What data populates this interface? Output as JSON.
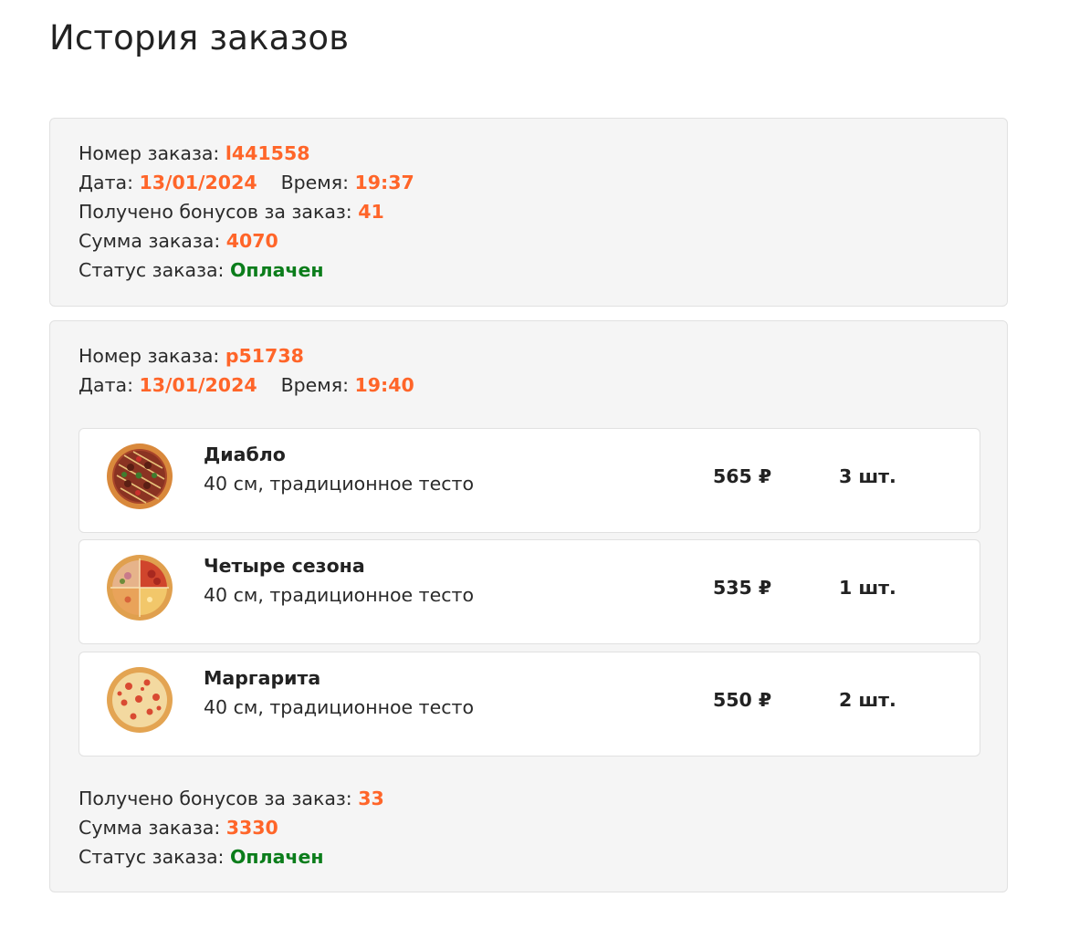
{
  "page": {
    "title": "История заказов"
  },
  "labels": {
    "order_number": "Номер заказа: ",
    "date": "Дата: ",
    "time": "Время: ",
    "bonuses": "Получено бонусов за заказ: ",
    "sum": "Сумма заказа: ",
    "status": "Статус заказа: "
  },
  "orders": [
    {
      "number": "l441558",
      "date": "13/01/2024",
      "time": "19:37",
      "bonuses": "41",
      "sum": "4070",
      "status": "Оплачен",
      "items": []
    },
    {
      "number": "p51738",
      "date": "13/01/2024",
      "time": "19:40",
      "bonuses": "33",
      "sum": "3330",
      "status": "Оплачен",
      "items": [
        {
          "name": "Диабло",
          "description": "40 см, традиционное тесто",
          "price": "565 ₽",
          "quantity": "3 шт.",
          "image": "pizza-diablo-image"
        },
        {
          "name": "Четыре сезона",
          "description": "40 см, традиционное тесто",
          "price": "535 ₽",
          "quantity": "1 шт.",
          "image": "pizza-four-seasons-image"
        },
        {
          "name": "Маргарита",
          "description": "40 см, традиционное тесто",
          "price": "550 ₽",
          "quantity": "2 шт.",
          "image": "pizza-margherita-image"
        }
      ]
    }
  ],
  "colors": {
    "accent": "#ff6529",
    "status_paid": "#0b7d1b",
    "card_bg": "#f5f5f5",
    "border": "#e1e1e1"
  }
}
